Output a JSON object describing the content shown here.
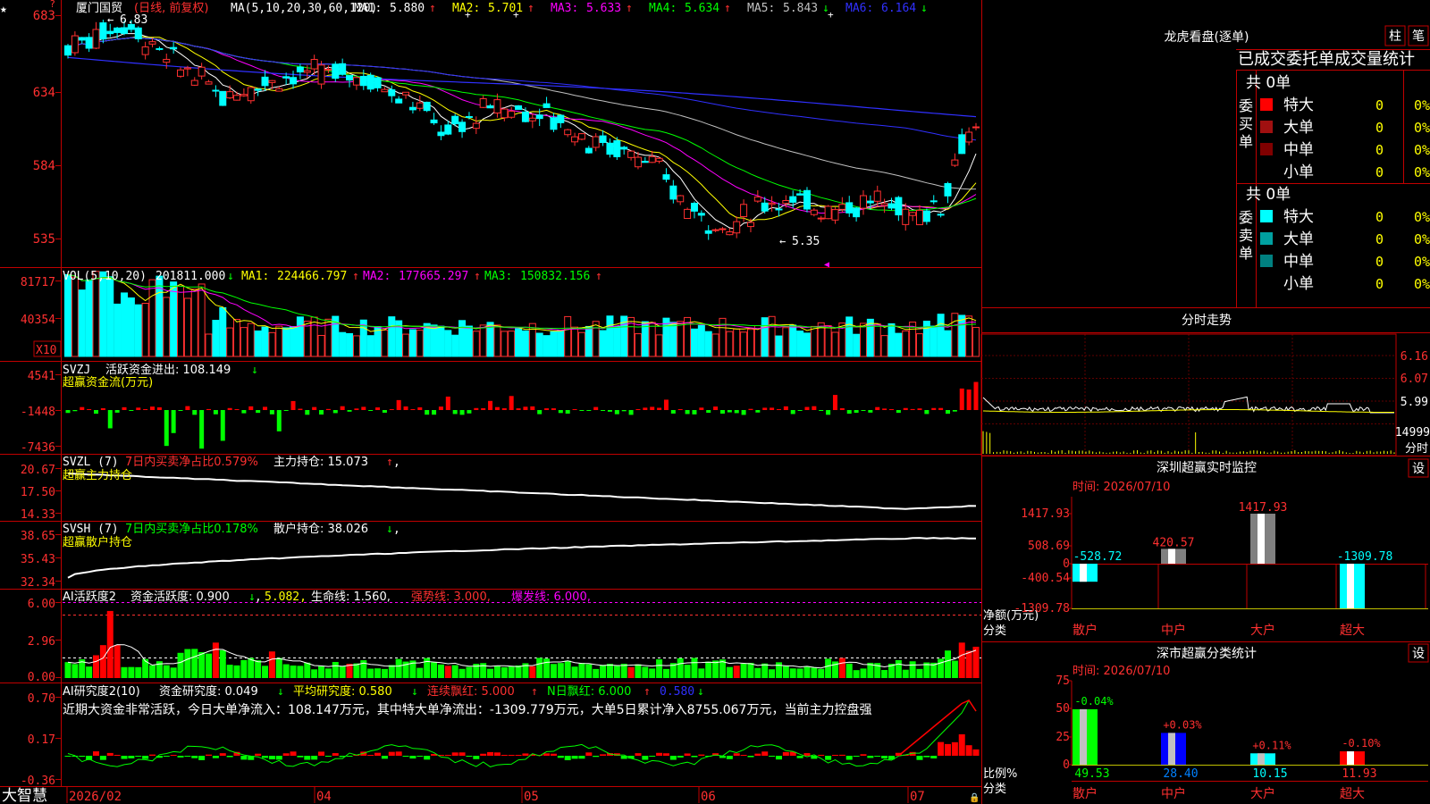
{
  "stock": {
    "name": "厦门国贸",
    "period": "(日线, 前复权)",
    "ma_label": "MA(5,10,20,30,60,120)",
    "ma": [
      {
        "label": "MA1:",
        "value": "5.880",
        "arrow": "↑",
        "color": "#ffffff"
      },
      {
        "label": "MA2:",
        "value": "5.701",
        "arrow": "↑",
        "color": "#ffff00"
      },
      {
        "label": "MA3:",
        "value": "5.633",
        "arrow": "↑",
        "color": "#ff00ff"
      },
      {
        "label": "MA4:",
        "value": "5.634",
        "arrow": "↑",
        "color": "#00ff00"
      },
      {
        "label": "MA5:",
        "value": "5.843",
        "arrow": "↓",
        "color": "#c0c0c0"
      },
      {
        "label": "MA6:",
        "value": "6.164",
        "arrow": "↓",
        "color": "#3030ff"
      }
    ],
    "high_mark": "6.83",
    "low_mark": "5.35",
    "price_axis": [
      "683",
      "634",
      "584",
      "535"
    ]
  },
  "volume": {
    "label": "VOL(5,10,20)",
    "value": "201811.000",
    "arrow": "↓",
    "ma": [
      {
        "label": "MA1:",
        "value": "224466.797",
        "arrow": "↑",
        "color": "#ffff00"
      },
      {
        "label": "MA2:",
        "value": "177665.297",
        "arrow": "↑",
        "color": "#ff00ff"
      },
      {
        "label": "MA3:",
        "value": "150832.156",
        "arrow": "↑",
        "color": "#00ff00"
      }
    ],
    "axis": [
      "81717",
      "40354"
    ],
    "unit": "X10"
  },
  "svzj": {
    "label": "SVZJ",
    "text": "活跃资金进出: 108.149",
    "arrow": "↓",
    "subtitle": "超赢资金流(万元)",
    "axis": [
      "4541",
      "-1448",
      "-7436"
    ]
  },
  "svzl": {
    "label": "SVZL (7)",
    "text1": "7日内买卖净占比0.579%",
    "text2": "主力持仓: 15.073",
    "arrow": "↑",
    "subtitle": "超赢主力持仓",
    "axis": [
      "20.67",
      "17.50",
      "14.33"
    ]
  },
  "svsh": {
    "label": "SVSH (7)",
    "text1": "7日内买卖净占比0.178%",
    "text2": "散户持仓: 38.026",
    "arrow": "↓",
    "subtitle": "超赢散户持仓",
    "axis": [
      "38.65",
      "35.43",
      "32.34"
    ]
  },
  "ai_active": {
    "label": "AI活跃度2",
    "t1": "资金活跃度: 0.900",
    "a1": "↓",
    "t2": "5.082,",
    "t3": "生命线: 1.560,",
    "t4": "强势线: 3.000,",
    "t5": "爆发线: 6.000,",
    "axis": [
      "6.00",
      "2.96",
      "0.00"
    ]
  },
  "ai_research": {
    "label": "AI研究度2(10)",
    "t1": "资金研究度: 0.049",
    "a1": "↓",
    "t2": "平均研究度: 0.580",
    "a2": "↓",
    "t3": "连续飘红: 5.000",
    "a3": "↑",
    "t4": "N日飘红: 6.000",
    "a4": "↑",
    "t5": "0.580",
    "a5": "↓",
    "commentary": "近期大资金非常活跃，今日大单净流入：108.147万元，其中特大单净流出：-1309.779万元，大单5日累计净入8755.067万元，当前主力控盘强",
    "axis": [
      "0.70",
      "0.17",
      "-0.36"
    ]
  },
  "footer": {
    "brand": "大智慧",
    "dates": [
      "2026/02",
      "04",
      "05",
      "06",
      "07"
    ]
  },
  "longhu": {
    "title": "龙虎看盘(逐单)",
    "btn1": "柱",
    "btn2": "笔",
    "header": "已成交委托单成交量统计",
    "buy_label": "委买单",
    "sell_label": "委卖单",
    "buy_total": "共 0单",
    "sell_total": "共 0单",
    "buy_rows": [
      {
        "name": "特大",
        "count": "0",
        "pct": "0%",
        "color": "#ff0000"
      },
      {
        "name": "大单",
        "count": "0",
        "pct": "0%",
        "color": "#a01010"
      },
      {
        "name": "中单",
        "count": "0",
        "pct": "0%",
        "color": "#800000"
      },
      {
        "name": "小单",
        "count": "0",
        "pct": "0%",
        "color": ""
      }
    ],
    "sell_rows": [
      {
        "name": "特大",
        "count": "0",
        "pct": "0%",
        "color": "#00ffff"
      },
      {
        "name": "大单",
        "count": "0",
        "pct": "0%",
        "color": "#00a0a0"
      },
      {
        "name": "中单",
        "count": "0",
        "pct": "0%",
        "color": "#008080"
      },
      {
        "name": "小单",
        "count": "0",
        "pct": "0%",
        "color": ""
      }
    ]
  },
  "intraday": {
    "title": "分时走势",
    "axis": [
      "6.16",
      "6.07",
      "5.99"
    ],
    "vol_label": "14999",
    "vol_sub": "分时"
  },
  "sz_monitor": {
    "title": "深圳超赢实时监控",
    "settings": "设",
    "time": "时间: 2026/07/10",
    "axis": [
      "1417.93",
      "508.69",
      "0",
      "-400.54",
      "-1309.78"
    ],
    "ylabel": "净额(万元)",
    "xlabel": "分类",
    "categories": [
      "散户",
      "中户",
      "大户",
      "超大"
    ],
    "values": [
      -528.72,
      420.57,
      1417.93,
      -1309.78
    ],
    "value_labels": [
      "-528.72",
      "420.57",
      "1417.93",
      "-1309.78"
    ]
  },
  "sz_stats": {
    "title": "深市超赢分类统计",
    "settings": "设",
    "time": "时间: 2026/07/10",
    "axis": [
      "75",
      "50",
      "25",
      "0"
    ],
    "ylabel": "比例%",
    "xlabel": "分类",
    "categories": [
      "散户",
      "中户",
      "大户",
      "超大"
    ],
    "values": [
      49.53,
      28.4,
      10.15,
      11.93
    ],
    "value_labels": [
      "49.53",
      "28.40",
      "10.15",
      "11.93"
    ],
    "changes": [
      "-0.04%",
      "+0.03%",
      "+0.11%",
      "-0.10%"
    ],
    "colors": [
      "#00ff00",
      "#0000ff",
      "#00ffff",
      "#ff0000"
    ]
  },
  "chart_data": [
    {
      "type": "candlestick",
      "title": "厦门国贸 (日线, 前复权)",
      "ylim": [
        5.35,
        6.83
      ],
      "x": [
        "2026/02",
        "04",
        "05",
        "06",
        "07"
      ],
      "series": [
        {
          "name": "MA1",
          "last": 5.88
        },
        {
          "name": "MA2",
          "last": 5.701
        },
        {
          "name": "MA3",
          "last": 5.633
        },
        {
          "name": "MA4",
          "last": 5.634
        },
        {
          "name": "MA5",
          "last": 5.843
        },
        {
          "name": "MA6",
          "last": 6.164
        }
      ]
    },
    {
      "type": "bar",
      "title": "深圳超赢实时监控",
      "categories": [
        "散户",
        "中户",
        "大户",
        "超大"
      ],
      "values": [
        -528.72,
        420.57,
        1417.93,
        -1309.78
      ],
      "ylabel": "净额(万元)",
      "ylim": [
        -1309.78,
        1417.93
      ]
    },
    {
      "type": "bar",
      "title": "深市超赢分类统计",
      "categories": [
        "散户",
        "中户",
        "大户",
        "超大"
      ],
      "values": [
        49.53,
        28.4,
        10.15,
        11.93
      ],
      "ylabel": "比例%",
      "ylim": [
        0,
        75
      ]
    }
  ]
}
